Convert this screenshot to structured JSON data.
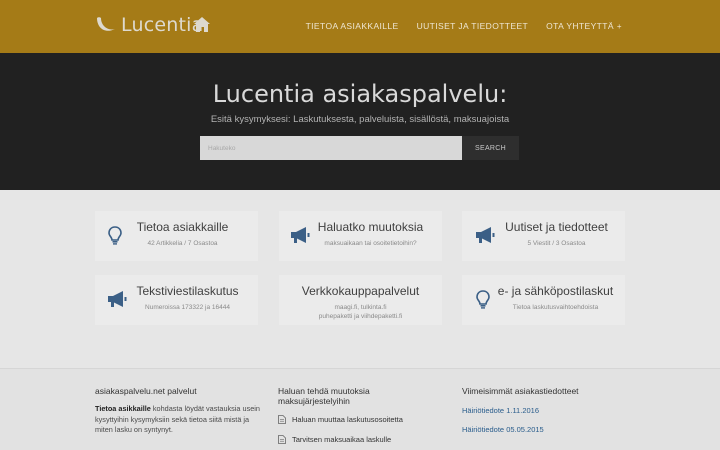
{
  "header": {
    "logo_text": "Lucentia",
    "nav": [
      {
        "label": "TIETOA ASIAKKAILLE"
      },
      {
        "label": "UUTISET JA TIEDOTTEET"
      },
      {
        "label": "OTA YHTEYTTÄ",
        "caret": "+"
      }
    ]
  },
  "hero": {
    "title": "Lucentia asiakaspalvelu:",
    "subtitle": "Esitä kysymyksesi: Laskutuksesta, palveluista, sisällöstä, maksuajoista",
    "search_placeholder": "Hakuteko",
    "search_button": "SEARCH"
  },
  "cards": [
    {
      "title": "Tietoa asiakkaille",
      "sub1": "42 Artikkelia / 7 Osastoa",
      "sub2": "",
      "icon": "lightbulb-icon"
    },
    {
      "title": "Haluatko muutoksia",
      "sub1": "maksuaikaan tai osoitetietoihin?",
      "sub2": "",
      "icon": "megaphone-icon"
    },
    {
      "title": "Uutiset ja tiedotteet",
      "sub1": "5 Viestit / 3 Osastoa",
      "sub2": "",
      "icon": "megaphone-icon"
    },
    {
      "title": "Tekstiviestilaskutus",
      "sub1": "Numeroissa 173322 ja 16444",
      "sub2": "",
      "icon": "megaphone-icon"
    },
    {
      "title": "Verkkokauppapalvelut",
      "sub1": "maagi.fi, tulkinta.fi",
      "sub2": "puhepaketti ja viihdepaketti.fi",
      "icon": ""
    },
    {
      "title": "e- ja sähköpostilaskut",
      "sub1": "Tietoa laskutusvaihtoehdoista",
      "sub2": "",
      "icon": "lightbulb-icon"
    }
  ],
  "footer": {
    "col1": {
      "heading": "asiakaspalvelu.net palvelut",
      "bold": "Tietoa asikkaille",
      "text": " kohdasta löydät vastauksia usein kysyttyihin kysymyksiin sekä tietoa siitä mistä ja miten lasku on syntynyt."
    },
    "col2": {
      "heading": "Haluan tehdä muutoksia maksujärjestelyihin",
      "items": [
        "Haluan muuttaa laskutusosoitetta",
        "Tarvitsen maksuaikaa laskulle"
      ]
    },
    "col3": {
      "heading": "Viimeisimmät asiakastiedotteet",
      "links": [
        "Häiriötiedote 1.11.2016",
        "Häiriötiedote 05.05.2015"
      ]
    }
  },
  "colors": {
    "topbar": "#a57b17",
    "hero": "#212121",
    "icon": "#3b5f86",
    "link": "#2a5d8c"
  }
}
